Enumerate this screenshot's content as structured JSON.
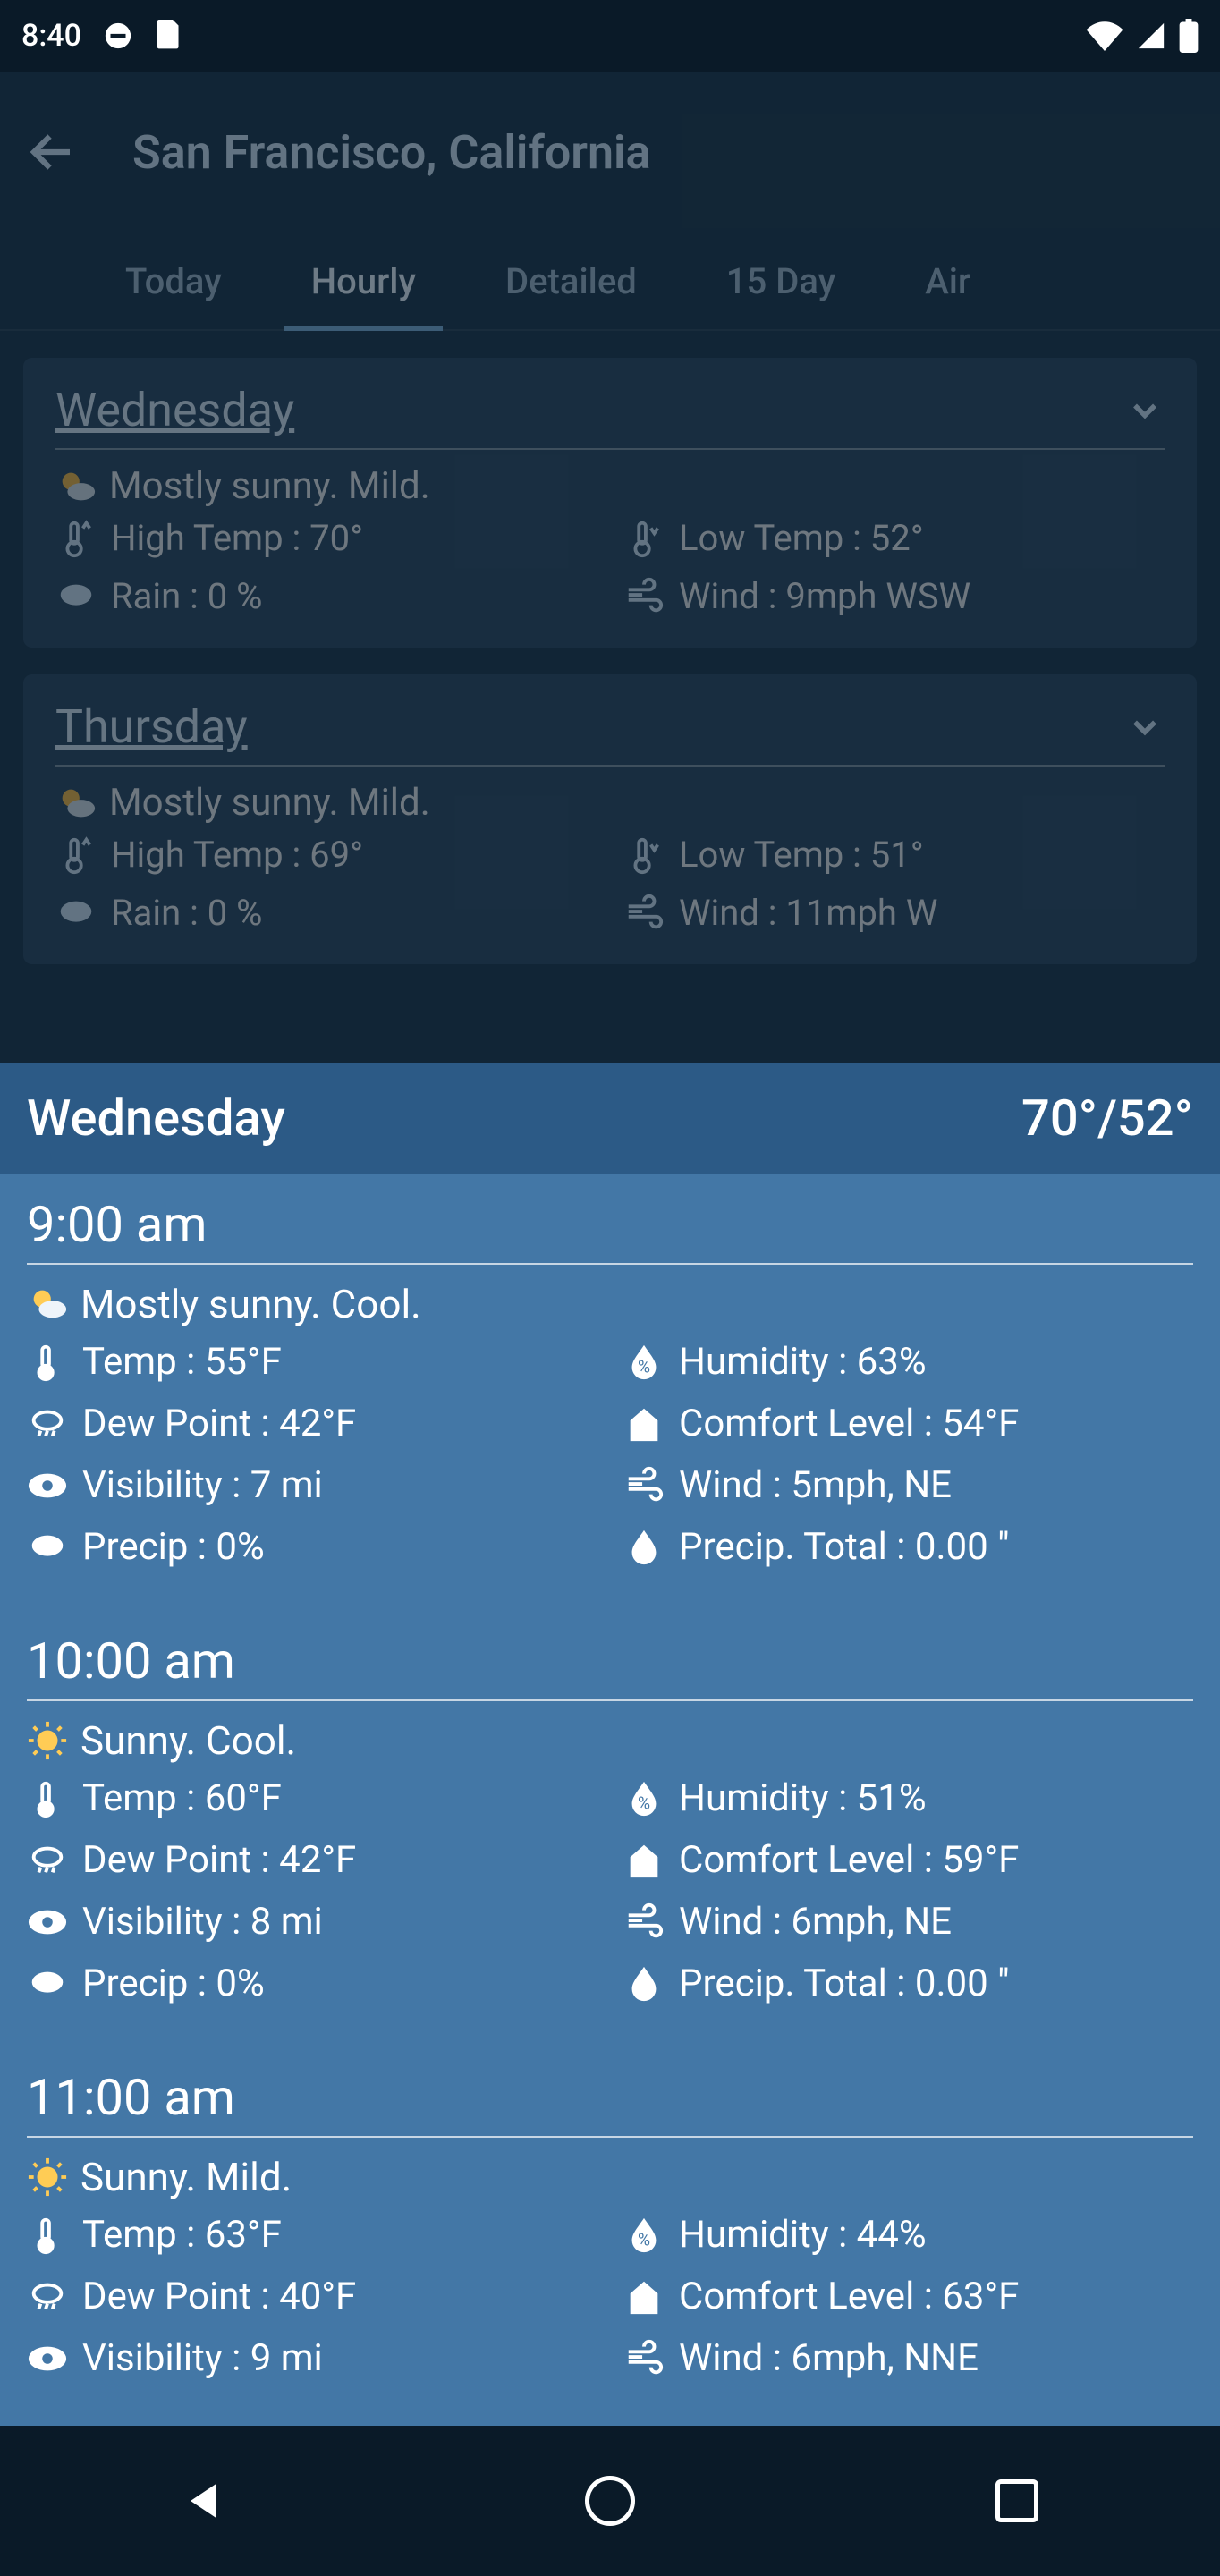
{
  "status": {
    "time": "8:40"
  },
  "header": {
    "title": "San Francisco, California"
  },
  "tabs": [
    {
      "label": "Today"
    },
    {
      "label": "Hourly"
    },
    {
      "label": "Detailed"
    },
    {
      "label": "15 Day"
    },
    {
      "label": "Air"
    }
  ],
  "days": [
    {
      "name": "Wednesday",
      "summary": "Mostly sunny. Mild.",
      "high": "High Temp : 70°",
      "low": "Low Temp : 52°",
      "rain": "Rain : 0 %",
      "wind": "Wind : 9mph WSW"
    },
    {
      "name": "Thursday",
      "summary": "Mostly sunny. Mild.",
      "high": "High Temp : 69°",
      "low": "Low Temp : 51°",
      "rain": "Rain : 0 %",
      "wind": "Wind : 11mph W"
    }
  ],
  "sheet": {
    "day": "Wednesday",
    "hilow": "70°/52°",
    "hours": [
      {
        "time": "9:00 am",
        "summary": "Mostly sunny. Cool.",
        "temp": "Temp : 55°F",
        "humidity": "Humidity : 63%",
        "dew": "Dew Point : 42°F",
        "comfort": "Comfort Level : 54°F",
        "vis": "Visibility : 7 mi",
        "wind": "Wind : 5mph, NE",
        "precip": "Precip : 0%",
        "ptotal": "Precip. Total : 0.00 \""
      },
      {
        "time": "10:00 am",
        "summary": "Sunny. Cool.",
        "temp": "Temp : 60°F",
        "humidity": "Humidity : 51%",
        "dew": "Dew Point : 42°F",
        "comfort": "Comfort Level : 59°F",
        "vis": "Visibility : 8 mi",
        "wind": "Wind : 6mph, NE",
        "precip": "Precip : 0%",
        "ptotal": "Precip. Total : 0.00 \""
      },
      {
        "time": "11:00 am",
        "summary": "Sunny. Mild.",
        "temp": "Temp : 63°F",
        "humidity": "Humidity : 44%",
        "dew": "Dew Point : 40°F",
        "comfort": "Comfort Level : 63°F",
        "vis": "Visibility : 9 mi",
        "wind": "Wind : 6mph, NNE",
        "precip": "",
        "ptotal": ""
      }
    ]
  }
}
